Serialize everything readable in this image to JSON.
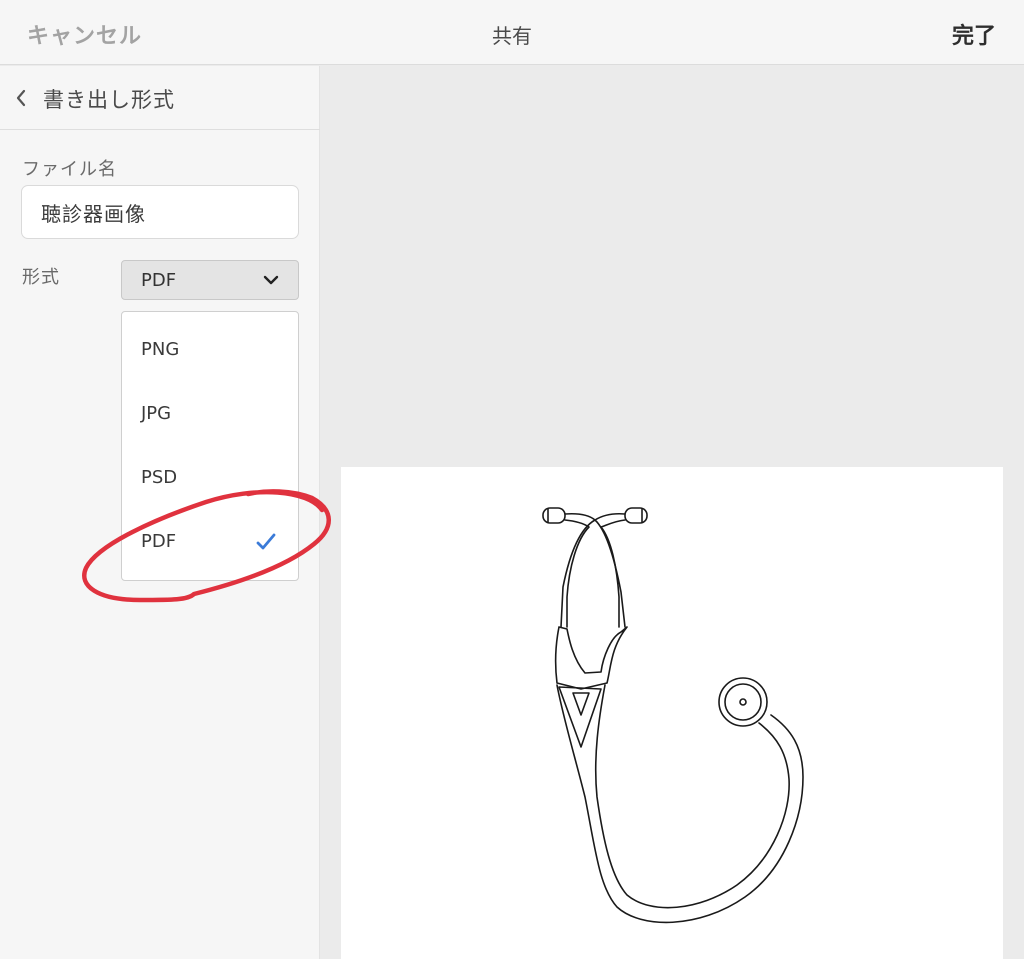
{
  "topbar": {
    "cancel_label": "キャンセル",
    "title": "共有",
    "done_label": "完了"
  },
  "panel": {
    "back_label": "書き出し形式",
    "filename_label": "ファイル名",
    "filename_value": "聴診器画像",
    "format_label": "形式",
    "format_selected": "PDF",
    "format_options": [
      "PNG",
      "JPG",
      "PSD",
      "PDF"
    ]
  },
  "colors": {
    "check": "#3b7bd8",
    "annotation": "#e0323e"
  },
  "icons": {
    "back": "chevron-left-icon",
    "dropdown": "chevron-down-icon",
    "selected": "checkmark-icon"
  }
}
